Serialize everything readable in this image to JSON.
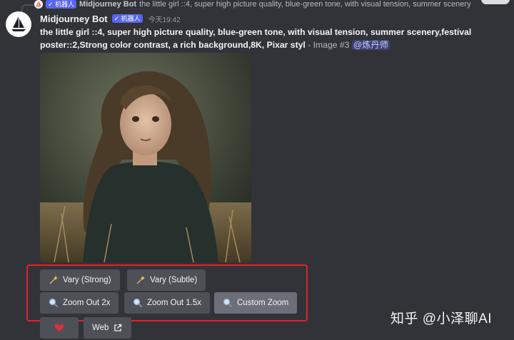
{
  "reply": {
    "badge": "✓ 机器人",
    "name": "Midjourney Bot",
    "text": "the little girl ::4, super high picture quality, blue-green tone, with visual tension, summer scenery"
  },
  "message": {
    "username": "Midjourney Bot",
    "badge": "✓ 机器人",
    "timestamp": "今天19:42",
    "prompt_bold": "the little girl ::4, super high picture quality, blue-green tone, with visual tension, summer scenery,festival poster::2,Strong color contrast, a rich background,8K, Pixar styl",
    "prompt_meta": " - Image #3 ",
    "mention": "@炼丹师"
  },
  "buttons": {
    "vary_strong": "Vary (Strong)",
    "vary_subtle": "Vary (Subtle)",
    "zoom_2x": "Zoom Out 2x",
    "zoom_15x": "Zoom Out 1.5x",
    "custom_zoom": "Custom Zoom",
    "web": "Web"
  },
  "watermark": "知乎 @小泽聊AI",
  "colors": {
    "background": "#313338",
    "button": "#4e5058",
    "highlight": "#e0242a",
    "badge": "#5865f2",
    "heart": "#dd2e44"
  }
}
